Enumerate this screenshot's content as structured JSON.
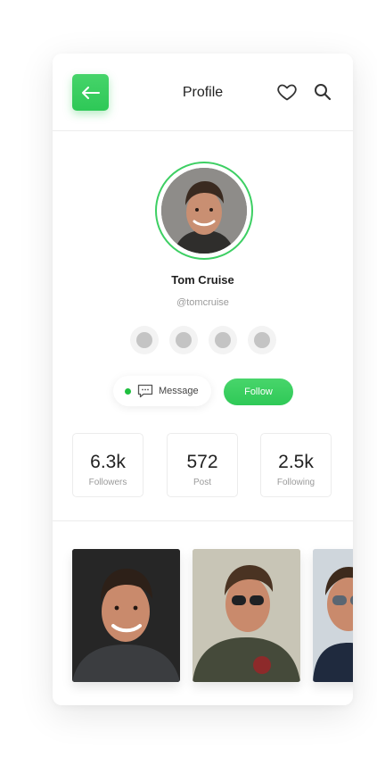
{
  "header": {
    "title": "Profile",
    "back_icon": "arrow-left-icon",
    "heart_icon": "heart-icon",
    "search_icon": "search-icon"
  },
  "profile": {
    "name": "Tom Cruise",
    "handle": "@tomcruise",
    "avatar": "avatar-photo"
  },
  "socials": [
    "social-icon-1",
    "social-icon-2",
    "social-icon-3",
    "social-icon-4"
  ],
  "actions": {
    "message_label": "Message",
    "follow_label": "Follow"
  },
  "stats": [
    {
      "value": "6.3k",
      "label": "Followers"
    },
    {
      "value": "572",
      "label": "Post"
    },
    {
      "value": "2.5k",
      "label": "Following"
    }
  ],
  "gallery": [
    "photo-portrait",
    "photo-aviator-jacket",
    "photo-aviator-sunglasses"
  ],
  "colors": {
    "accent_green": "#2ec857",
    "online_dot": "#1fbf3f",
    "text_dark": "#222222",
    "text_muted": "#9a9a9a"
  }
}
